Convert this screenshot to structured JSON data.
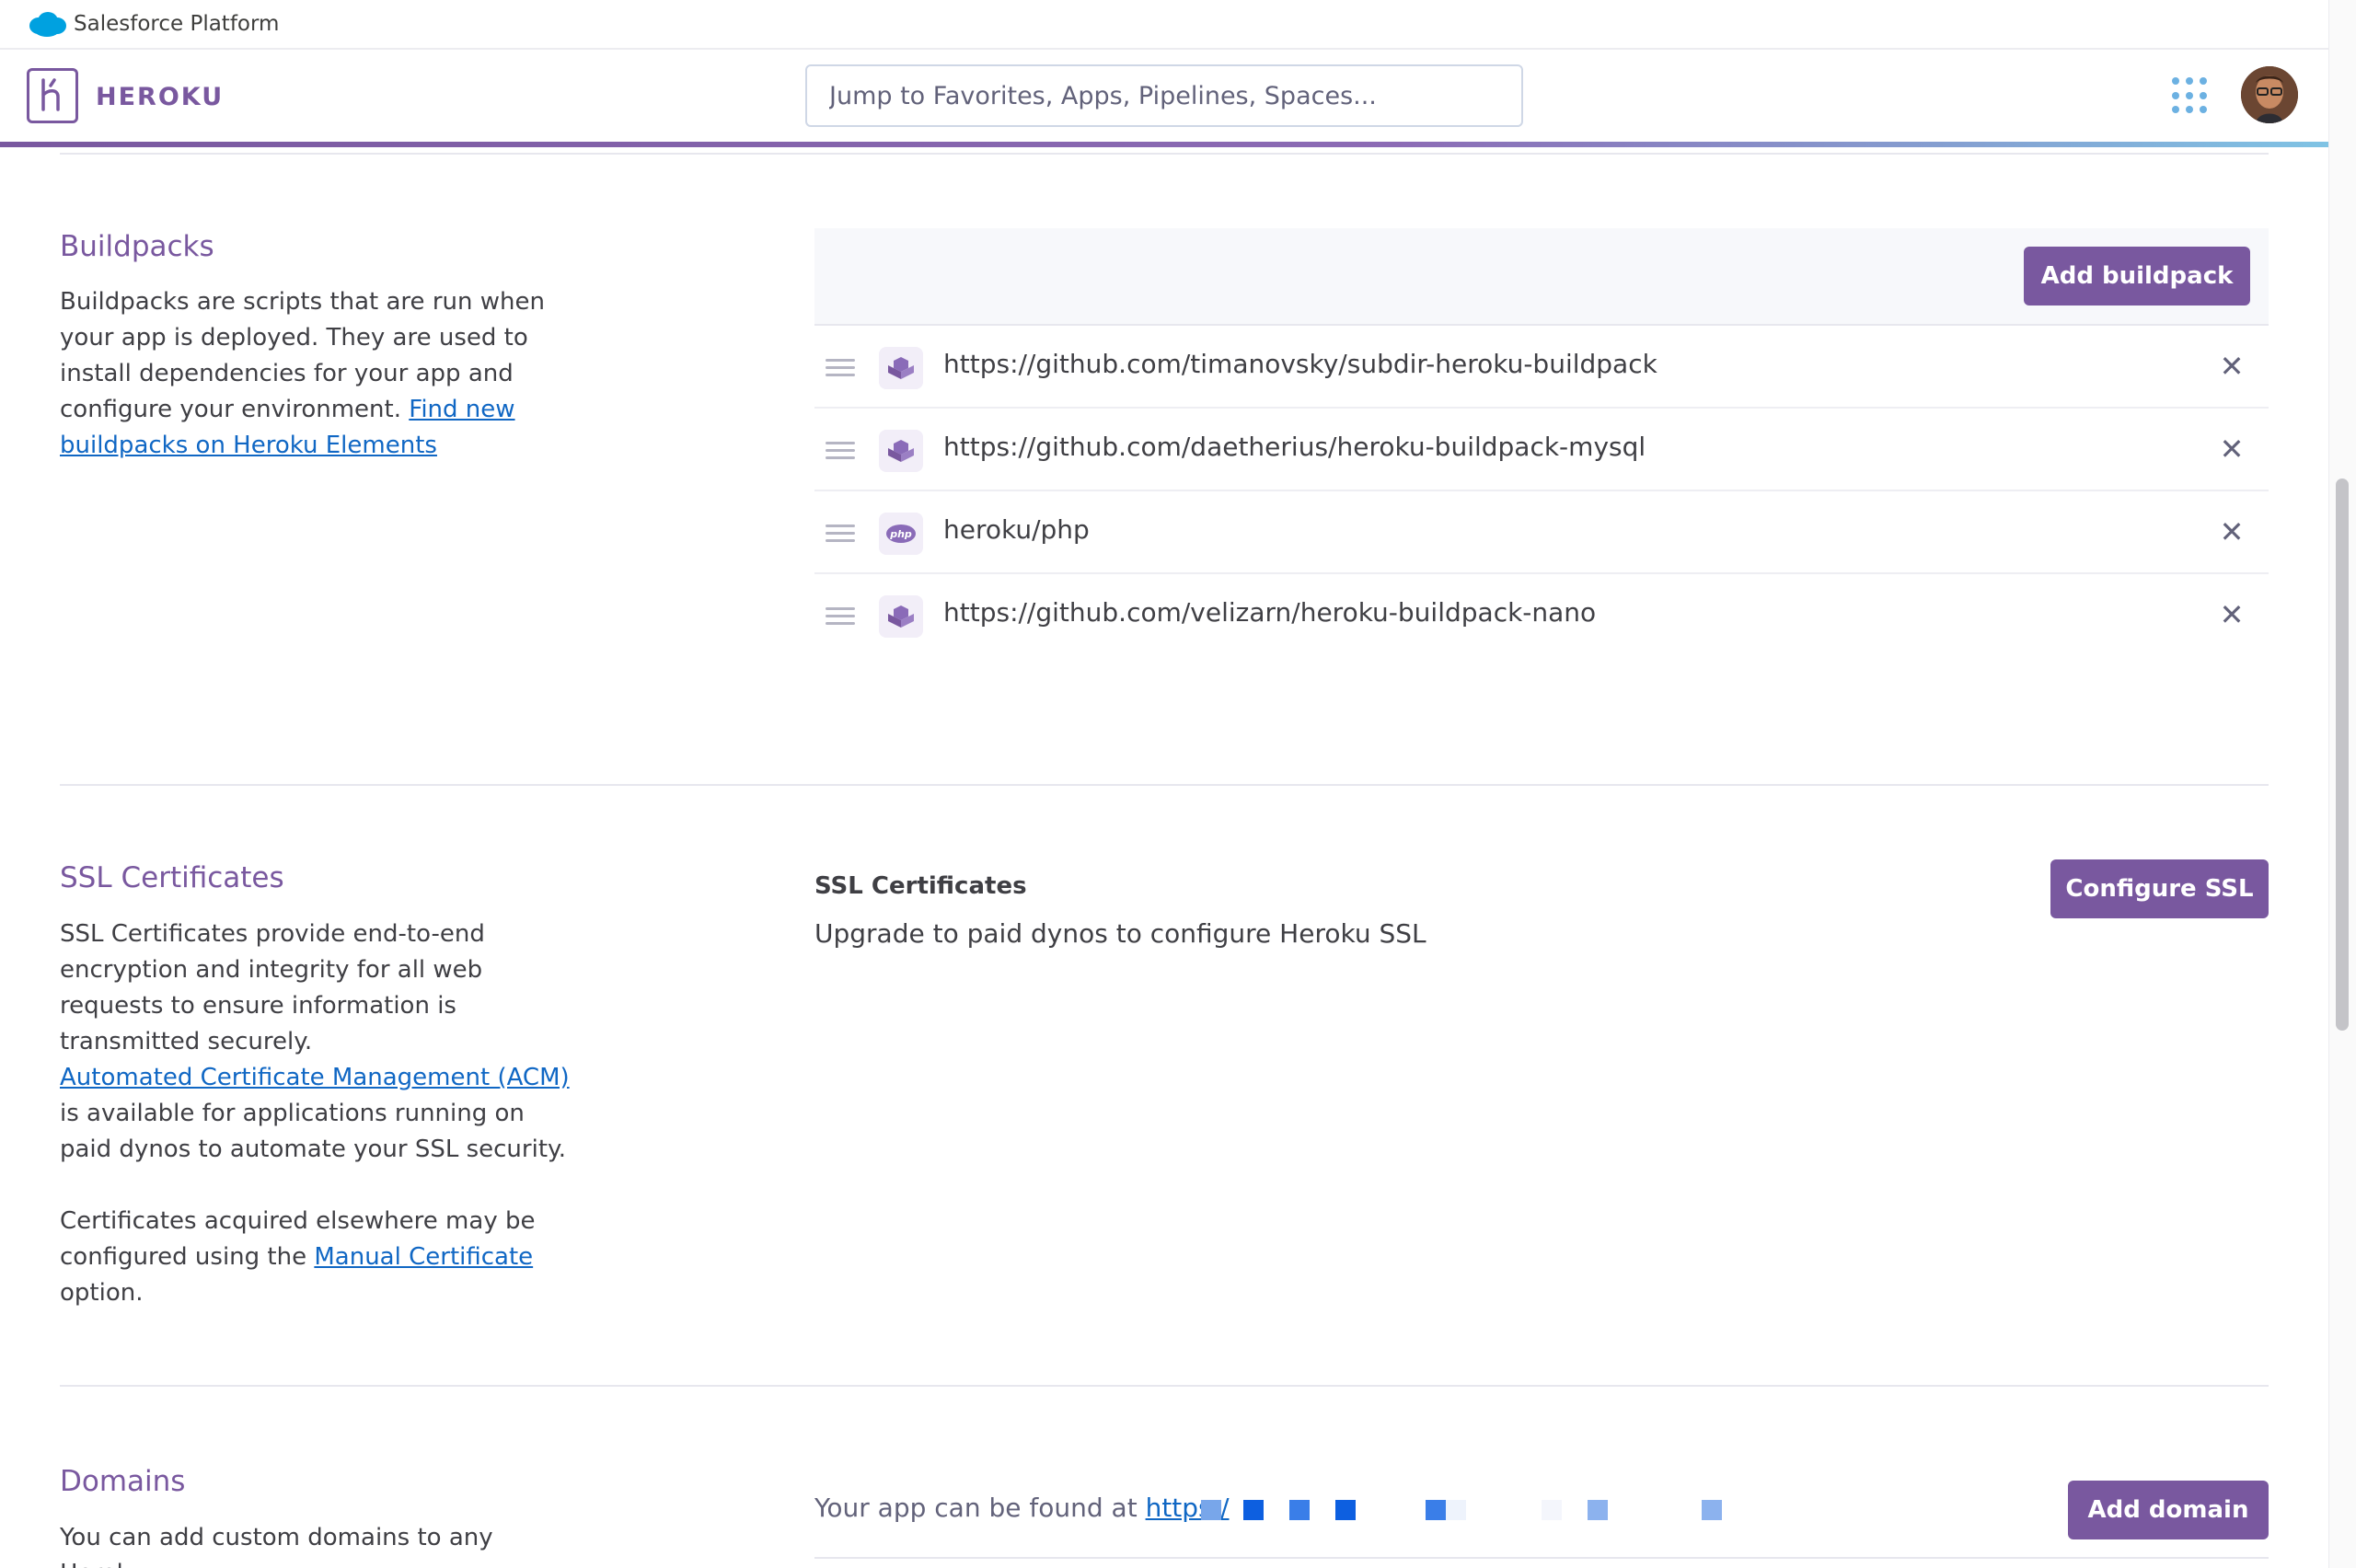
{
  "topbar": {
    "brand": "Salesforce Platform"
  },
  "header": {
    "wordmark": "HEROKU",
    "search_placeholder": "Jump to Favorites, Apps, Pipelines, Spaces..."
  },
  "buildpacks": {
    "title": "Buildpacks",
    "description": "Buildpacks are scripts that are run when your app is deployed. They are used to install dependencies for your app and configure your environment.",
    "link": "Find new buildpacks on Heroku Elements",
    "add_button": "Add buildpack",
    "items": [
      {
        "url": "https://github.com/timanovsky/subdir-heroku-buildpack",
        "icon": "buildpack-icon"
      },
      {
        "url": "https://github.com/daetherius/heroku-buildpack-mysql",
        "icon": "buildpack-icon"
      },
      {
        "url": "heroku/php",
        "icon": "php-icon"
      },
      {
        "url": "https://github.com/velizarn/heroku-buildpack-nano",
        "icon": "buildpack-icon"
      }
    ]
  },
  "ssl": {
    "title": "SSL Certificates",
    "desc1": "SSL Certificates provide end-to-end encryption and integrity for all web requests to ensure information is transmitted securely.",
    "acm_link": "Automated Certificate Management (ACM)",
    "desc2_suffix": "is available for applications running on paid dynos to automate your SSL security.",
    "desc3_prefix": "Certificates acquired elsewhere may be configured using the",
    "manual_link": "Manual Certificate",
    "desc3_suffix": "option.",
    "panel_heading": "SSL Certificates",
    "panel_text": "Upgrade to paid dynos to configure Heroku SSL",
    "button": "Configure SSL"
  },
  "domains": {
    "title": "Domains",
    "desc": "You can add custom domains to any Heroku",
    "found_text": "Your app can be found at",
    "url_visible": "https:/",
    "button": "Add domain"
  },
  "colors": {
    "accent": "#79589f",
    "link": "#1067c4",
    "apps_dots": "#6cb1e2"
  }
}
